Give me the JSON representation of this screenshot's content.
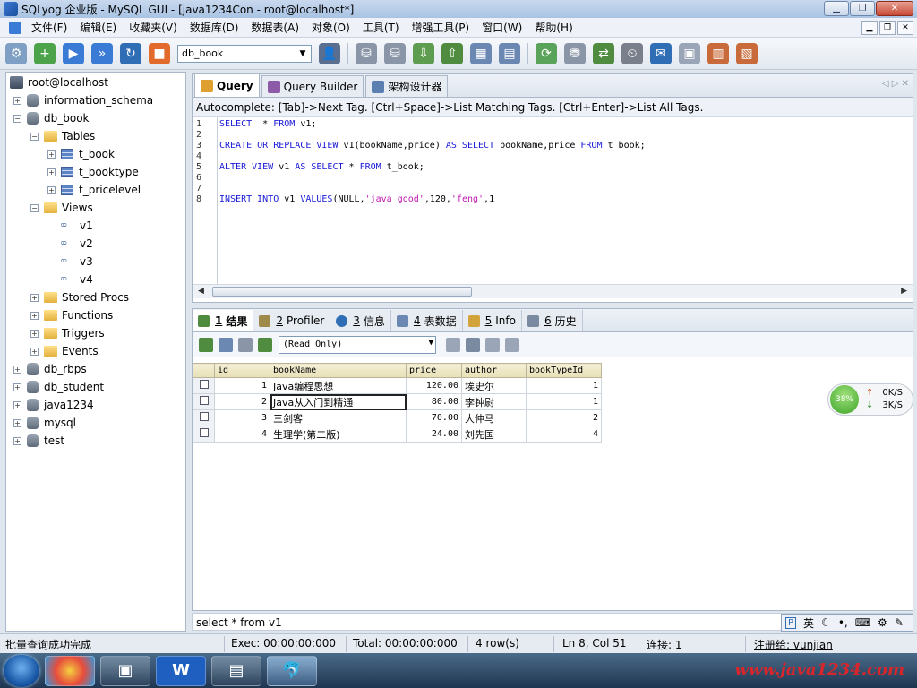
{
  "window": {
    "title": "SQLyog 企业版 - MySQL GUI - [java1234Con - root@localhost*]"
  },
  "menu": [
    "文件(F)",
    "编辑(E)",
    "收藏夹(V)",
    "数据库(D)",
    "数据表(A)",
    "对象(O)",
    "工具(T)",
    "增强工具(P)",
    "窗口(W)",
    "帮助(H)"
  ],
  "toolbar": {
    "db_selected": "db_book"
  },
  "tree": {
    "root": "root@localhost",
    "nodes": {
      "information_schema": "information_schema",
      "db_book": "db_book",
      "tables": "Tables",
      "t_book": "t_book",
      "t_booktype": "t_booktype",
      "t_pricelevel": "t_pricelevel",
      "views": "Views",
      "v1": "v1",
      "v2": "v2",
      "v3": "v3",
      "v4": "v4",
      "stored_procs": "Stored Procs",
      "functions": "Functions",
      "triggers": "Triggers",
      "events": "Events",
      "db_rbps": "db_rbps",
      "db_student": "db_student",
      "java1234": "java1234",
      "mysql": "mysql",
      "test": "test"
    }
  },
  "query_tabs": {
    "query": "Query",
    "builder": "Query Builder",
    "schema": "架构设计器"
  },
  "autocomplete": "Autocomplete: [Tab]->Next Tag. [Ctrl+Space]->List Matching Tags. [Ctrl+Enter]->List All Tags.",
  "editor": {
    "line_numbers": [
      "1",
      "2",
      "3",
      "4",
      "5",
      "6",
      "7",
      "8"
    ],
    "line1": {
      "a": "SELECT",
      "b": "  * ",
      "c": "FROM",
      "d": " v1;"
    },
    "line3": {
      "a": "CREATE OR REPLACE VIEW",
      "b": " v1(bookName,price) ",
      "c": "AS SELECT",
      "d": " bookName,price ",
      "e": "FROM",
      "f": " t_book;"
    },
    "line5": {
      "a": "ALTER VIEW",
      "b": " v1 ",
      "c": "AS SELECT",
      "d": " * ",
      "e": "FROM",
      "f": " t_book;"
    },
    "line8": {
      "a": "INSERT INTO",
      "b": " v1 ",
      "c": "VALUES",
      "d": "(NULL,",
      "e": "'java good'",
      "f": ",120,",
      "g": "'feng'",
      "h": ",1"
    }
  },
  "result_tabs": {
    "t1": {
      "num": "1",
      "label": "结果"
    },
    "t2": {
      "num": "2",
      "label": "Profiler"
    },
    "t3": {
      "num": "3",
      "label": "信息"
    },
    "t4": {
      "num": "4",
      "label": "表数据"
    },
    "t5": {
      "num": "5",
      "label": "Info"
    },
    "t6": {
      "num": "6",
      "label": "历史"
    }
  },
  "result_mode": "(Read Only)",
  "grid": {
    "columns": [
      "id",
      "bookName",
      "price",
      "author",
      "bookTypeId"
    ],
    "rows": [
      {
        "id": "1",
        "bookName": "Java编程思想",
        "price": "120.00",
        "author": "埃史尔",
        "bookTypeId": "1"
      },
      {
        "id": "2",
        "bookName": "Java从入门到精通",
        "price": "80.00",
        "author": "李钟尉",
        "bookTypeId": "1"
      },
      {
        "id": "3",
        "bookName": "三剑客",
        "price": "70.00",
        "author": "大仲马",
        "bookTypeId": "2"
      },
      {
        "id": "4",
        "bookName": "生理学(第二版)",
        "price": "24.00",
        "author": "刘先国",
        "bookTypeId": "4"
      }
    ]
  },
  "query_status": "select  * from v1",
  "ime": {
    "mode": "英"
  },
  "speed": {
    "percent": "38%",
    "up": "0K/S",
    "down": "3K/S"
  },
  "status": {
    "message": "批量查询成功完成",
    "exec": "Exec: 00:00:00:000",
    "total": "Total: 00:00:00:000",
    "rows": "4 row(s)",
    "position": "Ln 8, Col 51",
    "connections": "连接: 1",
    "registered": "注册给: vunjian"
  },
  "watermark": "www.java1234.com"
}
